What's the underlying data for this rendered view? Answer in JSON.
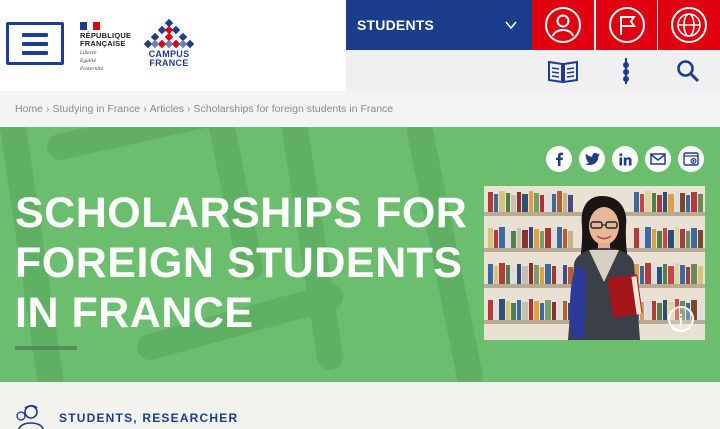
{
  "header": {
    "republic_logo": {
      "lines": [
        "RÉPUBLIQUE",
        "FRANÇAISE"
      ],
      "motto": [
        "Liberté",
        "Égalité",
        "Fraternité"
      ]
    },
    "campus_logo": {
      "lines": [
        "CAMPUS",
        "FRANCE"
      ]
    },
    "audience_selector": "STUDENTS",
    "colors": {
      "brand_blue": "#1c3c8c",
      "accent_red": "#e1000f",
      "hero_green": "#6bbe6e"
    }
  },
  "breadcrumb": [
    "Home",
    "Studying in France",
    "Articles",
    "Scholarships for foreign students in France"
  ],
  "hero": {
    "title": "SCHOLARSHIPS FOR FOREIGN STUDENTS IN FRANCE",
    "share_icons": [
      "facebook-icon",
      "twitter-icon",
      "linkedin-icon",
      "email-icon",
      "bookmark-icon"
    ]
  },
  "audience": "STUDENTS, RESEARCHER"
}
